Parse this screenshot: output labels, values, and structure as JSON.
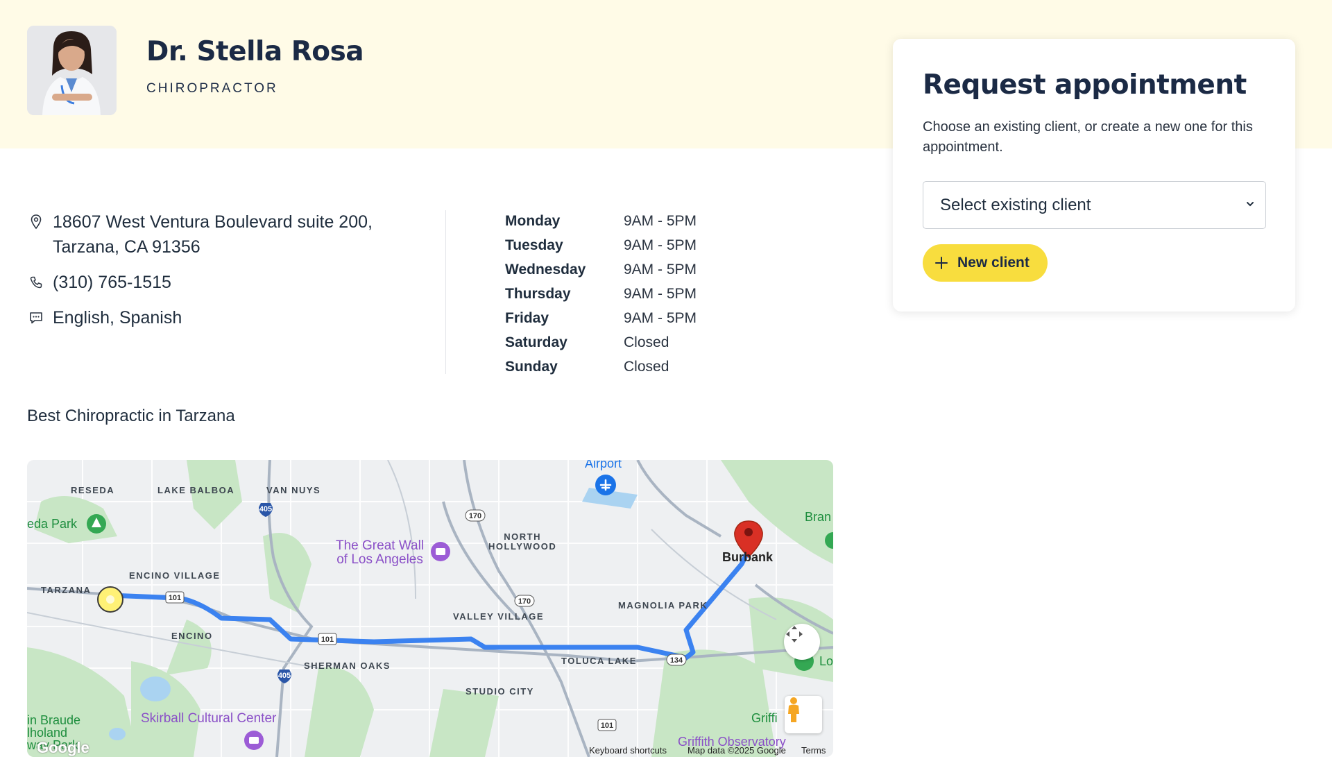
{
  "doctor": {
    "name": "Dr. Stella Rosa",
    "title": "CHIROPRACTOR"
  },
  "contact": {
    "address_line1": "18607 West Ventura Boulevard suite 200,",
    "address_line2": "Tarzana, CA 91356",
    "phone": "(310) 765-1515",
    "languages": "English, Spanish"
  },
  "hours": [
    {
      "day": "Monday",
      "time": "9AM - 5PM"
    },
    {
      "day": "Tuesday",
      "time": "9AM - 5PM"
    },
    {
      "day": "Wednesday",
      "time": "9AM - 5PM"
    },
    {
      "day": "Thursday",
      "time": "9AM - 5PM"
    },
    {
      "day": "Friday",
      "time": "9AM - 5PM"
    },
    {
      "day": "Saturday",
      "time": "Closed"
    },
    {
      "day": "Sunday",
      "time": "Closed"
    }
  ],
  "tagline": "Best Chiropractic in Tarzana",
  "map": {
    "neighborhoods": {
      "reseda": "RESEDA",
      "lake_balboa": "LAKE BALBOA",
      "van_nuys": "VAN NUYS",
      "north_hollywood": "NORTH\nHOLLYWOOD",
      "encino_village": "ENCINO VILLAGE",
      "tarzana": "TARZANA",
      "encino": "ENCINO",
      "valley_village": "VALLEY VILLAGE",
      "magnolia_park": "MAGNOLIA PARK",
      "sherman_oaks": "SHERMAN OAKS",
      "toluca_lake": "TOLUCA LAKE",
      "studio_city": "STUDIO CITY"
    },
    "pois": {
      "great_wall_line1": "The Great Wall",
      "great_wall_line2": "of Los Angeles",
      "skirball": "Skirball Cultural Center",
      "griffith": "Griffith Observatory"
    },
    "places": {
      "airport": "Airport",
      "reseda_park": "eda Park",
      "burbank": "Burbank",
      "bran": "Bran",
      "brauder_line1": "in Braude",
      "brauder_line2": "lholand",
      "brauder_line3": "way Park",
      "griffith_short": "Griffi",
      "lo": "Lo"
    },
    "shields": [
      "405",
      "405",
      "170",
      "170",
      "101",
      "101",
      "101",
      "134"
    ],
    "footer": {
      "logo": "Google",
      "shortcuts": "Keyboard shortcuts",
      "map_data": "Map data ©2025 Google",
      "terms": "Terms"
    },
    "colors": {
      "route": "#3b82f0",
      "park": "#c8e6c5",
      "water": "#aad3f1",
      "pin": "#d93025",
      "origin": "#fff176"
    }
  },
  "appointment": {
    "title": "Request appointment",
    "description": "Choose an existing client, or create a new one for this appointment.",
    "select_placeholder": "Select existing client",
    "new_client_label": "New client"
  },
  "theme": {
    "hero_bg": "#fffbe7",
    "accent": "#f8dd3e",
    "heading": "#1b2a45"
  }
}
